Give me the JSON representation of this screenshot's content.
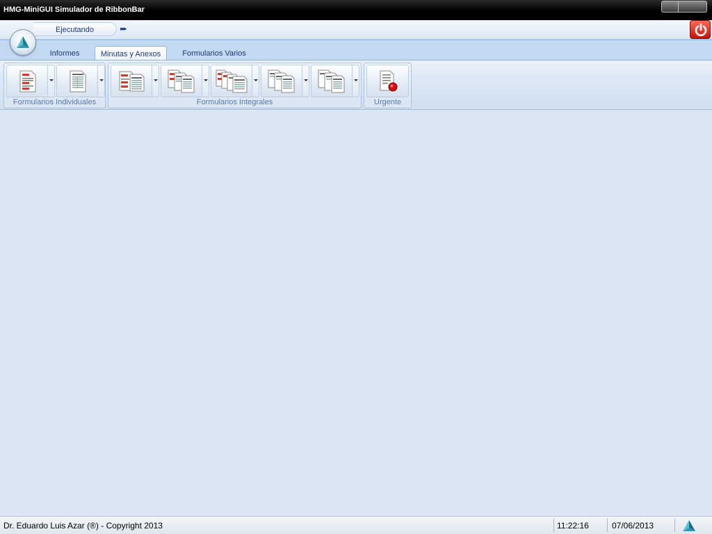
{
  "window": {
    "title": "HMG-MiniGUI Simulador de RibbonBar"
  },
  "quick_access": {
    "label": "Ejecutando",
    "more": "▸▸▸"
  },
  "tabs": [
    {
      "label": "Informes"
    },
    {
      "label": "Minutas y Anexos"
    },
    {
      "label": "Formularios Varios"
    }
  ],
  "ribbon": {
    "groups": [
      {
        "label": "Formularios Individuales"
      },
      {
        "label": "Formularios Integrales"
      },
      {
        "label": "Urgente"
      }
    ]
  },
  "statusbar": {
    "copyright": "Dr. Eduardo Luis Azar (®) - Copyright 2013",
    "time": "11:22:16",
    "date": "07/06/2013"
  },
  "colors": {
    "accent": "#1d3a78",
    "group_label": "#5a79a8",
    "power": "#c4120a"
  },
  "icons": {
    "orb": "app-orb-icon",
    "power": "power-icon",
    "document": "document-icon",
    "urgent": "urgent-document-icon"
  }
}
